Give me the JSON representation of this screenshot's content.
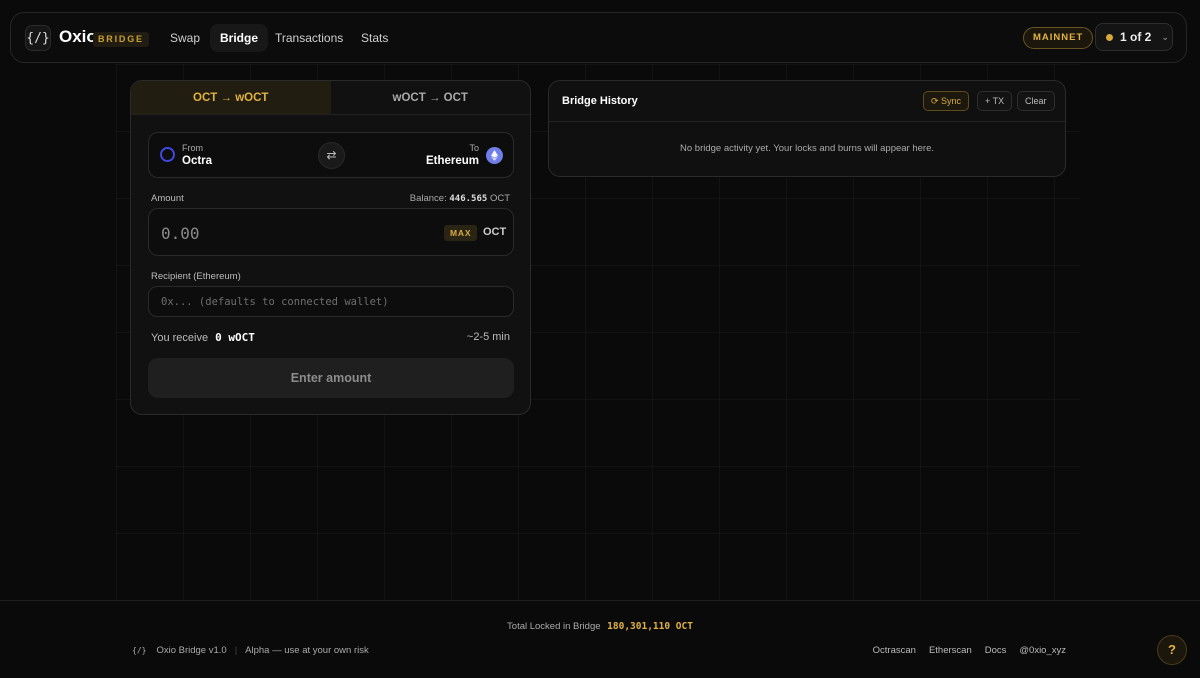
{
  "app": {
    "logo_glyph": "{/}",
    "name": "Oxio",
    "badge": "BRIDGE"
  },
  "nav": {
    "items": [
      {
        "label": "Swap"
      },
      {
        "label": "Bridge",
        "active": true
      },
      {
        "label": "Transactions"
      },
      {
        "label": "Stats"
      }
    ]
  },
  "header": {
    "network": "MAINNET",
    "account": "1 of 2",
    "account_dot_color": "#d8a93a"
  },
  "bridge": {
    "tabs": [
      {
        "label": "OCT → wOCT",
        "active": true
      },
      {
        "label": "wOCT → OCT"
      }
    ],
    "from_label": "From",
    "from_value": "Octra",
    "to_label": "To",
    "to_value": "Ethereum",
    "swap_icon": "⇄",
    "amount_label": "Amount",
    "balance_label": "Balance:",
    "balance_value": "446.565",
    "balance_unit": "OCT",
    "amount_placeholder": "0.00",
    "max_label": "MAX",
    "amount_unit": "OCT",
    "recipient_label": "Recipient (Ethereum)",
    "recipient_placeholder": "0x... (defaults to connected wallet)",
    "receive_label": "You receive",
    "receive_value": "0 wOCT",
    "eta": "~2-5 min",
    "submit_label": "Enter amount"
  },
  "history": {
    "title": "Bridge History",
    "sync_label": "⟳ Sync",
    "tx_label": "+ TX",
    "clear_label": "Clear",
    "empty_text": "No bridge activity yet. Your locks and burns will appear here."
  },
  "footer": {
    "locked_label": "Total Locked in Bridge",
    "locked_value": "180,301,110 OCT",
    "mini_logo": "{/}",
    "version": "Oxio Bridge v1.0",
    "warning": "Alpha — use at your own risk",
    "links": [
      "Octrascan",
      "Etherscan",
      "Docs",
      "@0xio_xyz"
    ],
    "help": "?"
  },
  "colors": {
    "accent": "#e2b340",
    "background": "#0a0a0a",
    "octra_blue": "#3d49e0",
    "eth_purple": "#6f7ee8"
  }
}
